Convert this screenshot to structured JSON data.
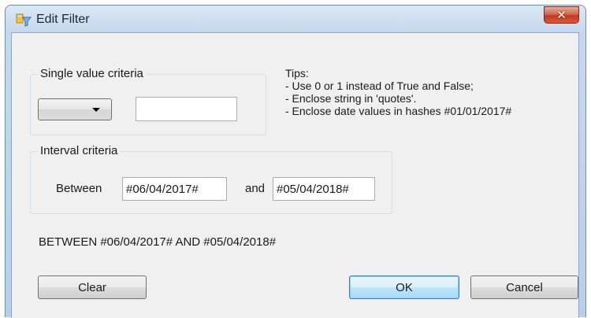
{
  "window": {
    "title": "Edit Filter",
    "close_label": "✕",
    "app_icon": "filter-tool-icon"
  },
  "single_value": {
    "group_label": "Single value criteria",
    "operator_value": "",
    "value_text": ""
  },
  "tips": {
    "heading": "Tips:",
    "lines": [
      "- Use 0 or 1 instead of True and False;",
      "- Enclose string in 'quotes'.",
      "- Enclose date values in hashes #01/01/2017#"
    ]
  },
  "interval": {
    "group_label": "Interval criteria",
    "between_label": "Between",
    "between_value": "#06/04/2017#",
    "and_label": "and",
    "and_value": "#05/04/2018#"
  },
  "result_expression": "BETWEEN #06/04/2017# AND #05/04/2018#",
  "buttons": {
    "clear": "Clear",
    "ok": "OK",
    "cancel": "Cancel"
  },
  "colors": {
    "title_bar": "#c5d8ee",
    "close_button": "#c4391c",
    "client_bg": "#f0f0f0",
    "focus_border": "#569de5"
  }
}
